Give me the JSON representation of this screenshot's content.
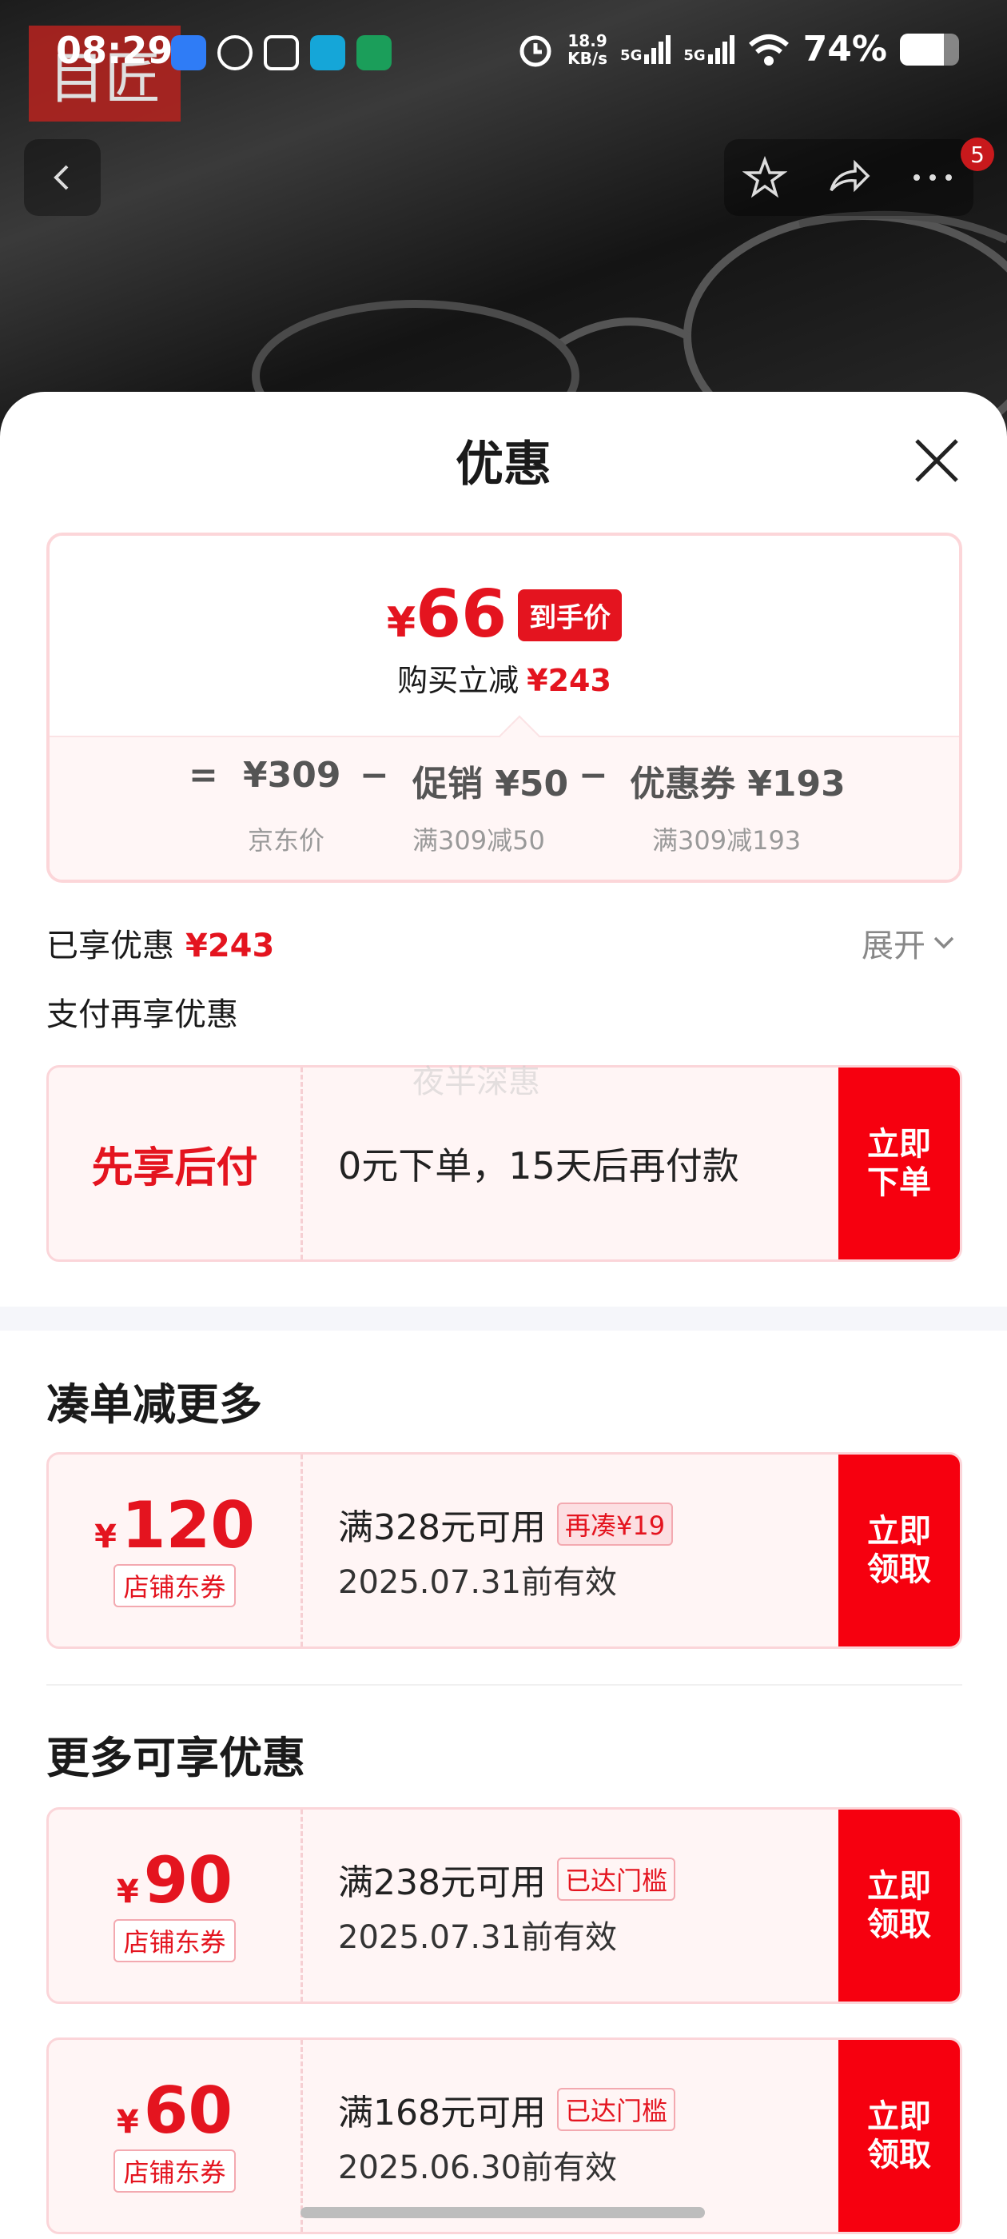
{
  "status_bar": {
    "time": "08:29",
    "net_speed_value": "18.9",
    "net_speed_unit": "KB/s",
    "sig1_label": "5G",
    "sig2_label": "5G",
    "battery_text": "74%",
    "battery_level": 0.74
  },
  "top_nav": {
    "cart_badge": "5"
  },
  "sheet": {
    "title": "优惠"
  },
  "price_card": {
    "yen": "¥",
    "final_price": "66",
    "final_price_tag": "到手价",
    "reduce_label": "购买立减",
    "reduce_amount": "¥243",
    "eq": "=",
    "jd_price": "¥309",
    "minus1": "−",
    "promo": "促销 ¥50",
    "minus2": "−",
    "coupon": "优惠券 ¥193",
    "jd_price_label": "京东价",
    "promo_sub": "满309减50",
    "coupon_sub": "满309减193"
  },
  "enjoyed": {
    "label": "已享优惠",
    "amount": "¥243",
    "expand_label": "展开"
  },
  "pay_more": {
    "label": "支付再享优惠",
    "watermark": "夜半深惠"
  },
  "pay_later": {
    "title": "先享后付",
    "desc": "0元下单，15天后再付款",
    "button": "立即\n下单"
  },
  "section1": {
    "title": "凑单减更多",
    "coupons": [
      {
        "yen": "¥",
        "amount": "120",
        "type": "店铺东券",
        "condition": "满328元可用",
        "tag": "再凑¥19",
        "valid": "2025.07.31前有效",
        "button": "立即\n领取"
      }
    ]
  },
  "section2": {
    "title": "更多可享优惠",
    "coupons": [
      {
        "yen": "¥",
        "amount": "90",
        "type": "店铺东券",
        "condition": "满238元可用",
        "tag": "已达门槛",
        "valid": "2025.07.31前有效",
        "button": "立即\n领取"
      },
      {
        "yen": "¥",
        "amount": "60",
        "type": "店铺东券",
        "condition": "满168元可用",
        "tag": "已达门槛",
        "valid": "2025.06.30前有效",
        "button": "立即\n领取"
      }
    ]
  },
  "colors": {
    "accent_red": "#e4141f",
    "button_red": "#f6000f"
  }
}
